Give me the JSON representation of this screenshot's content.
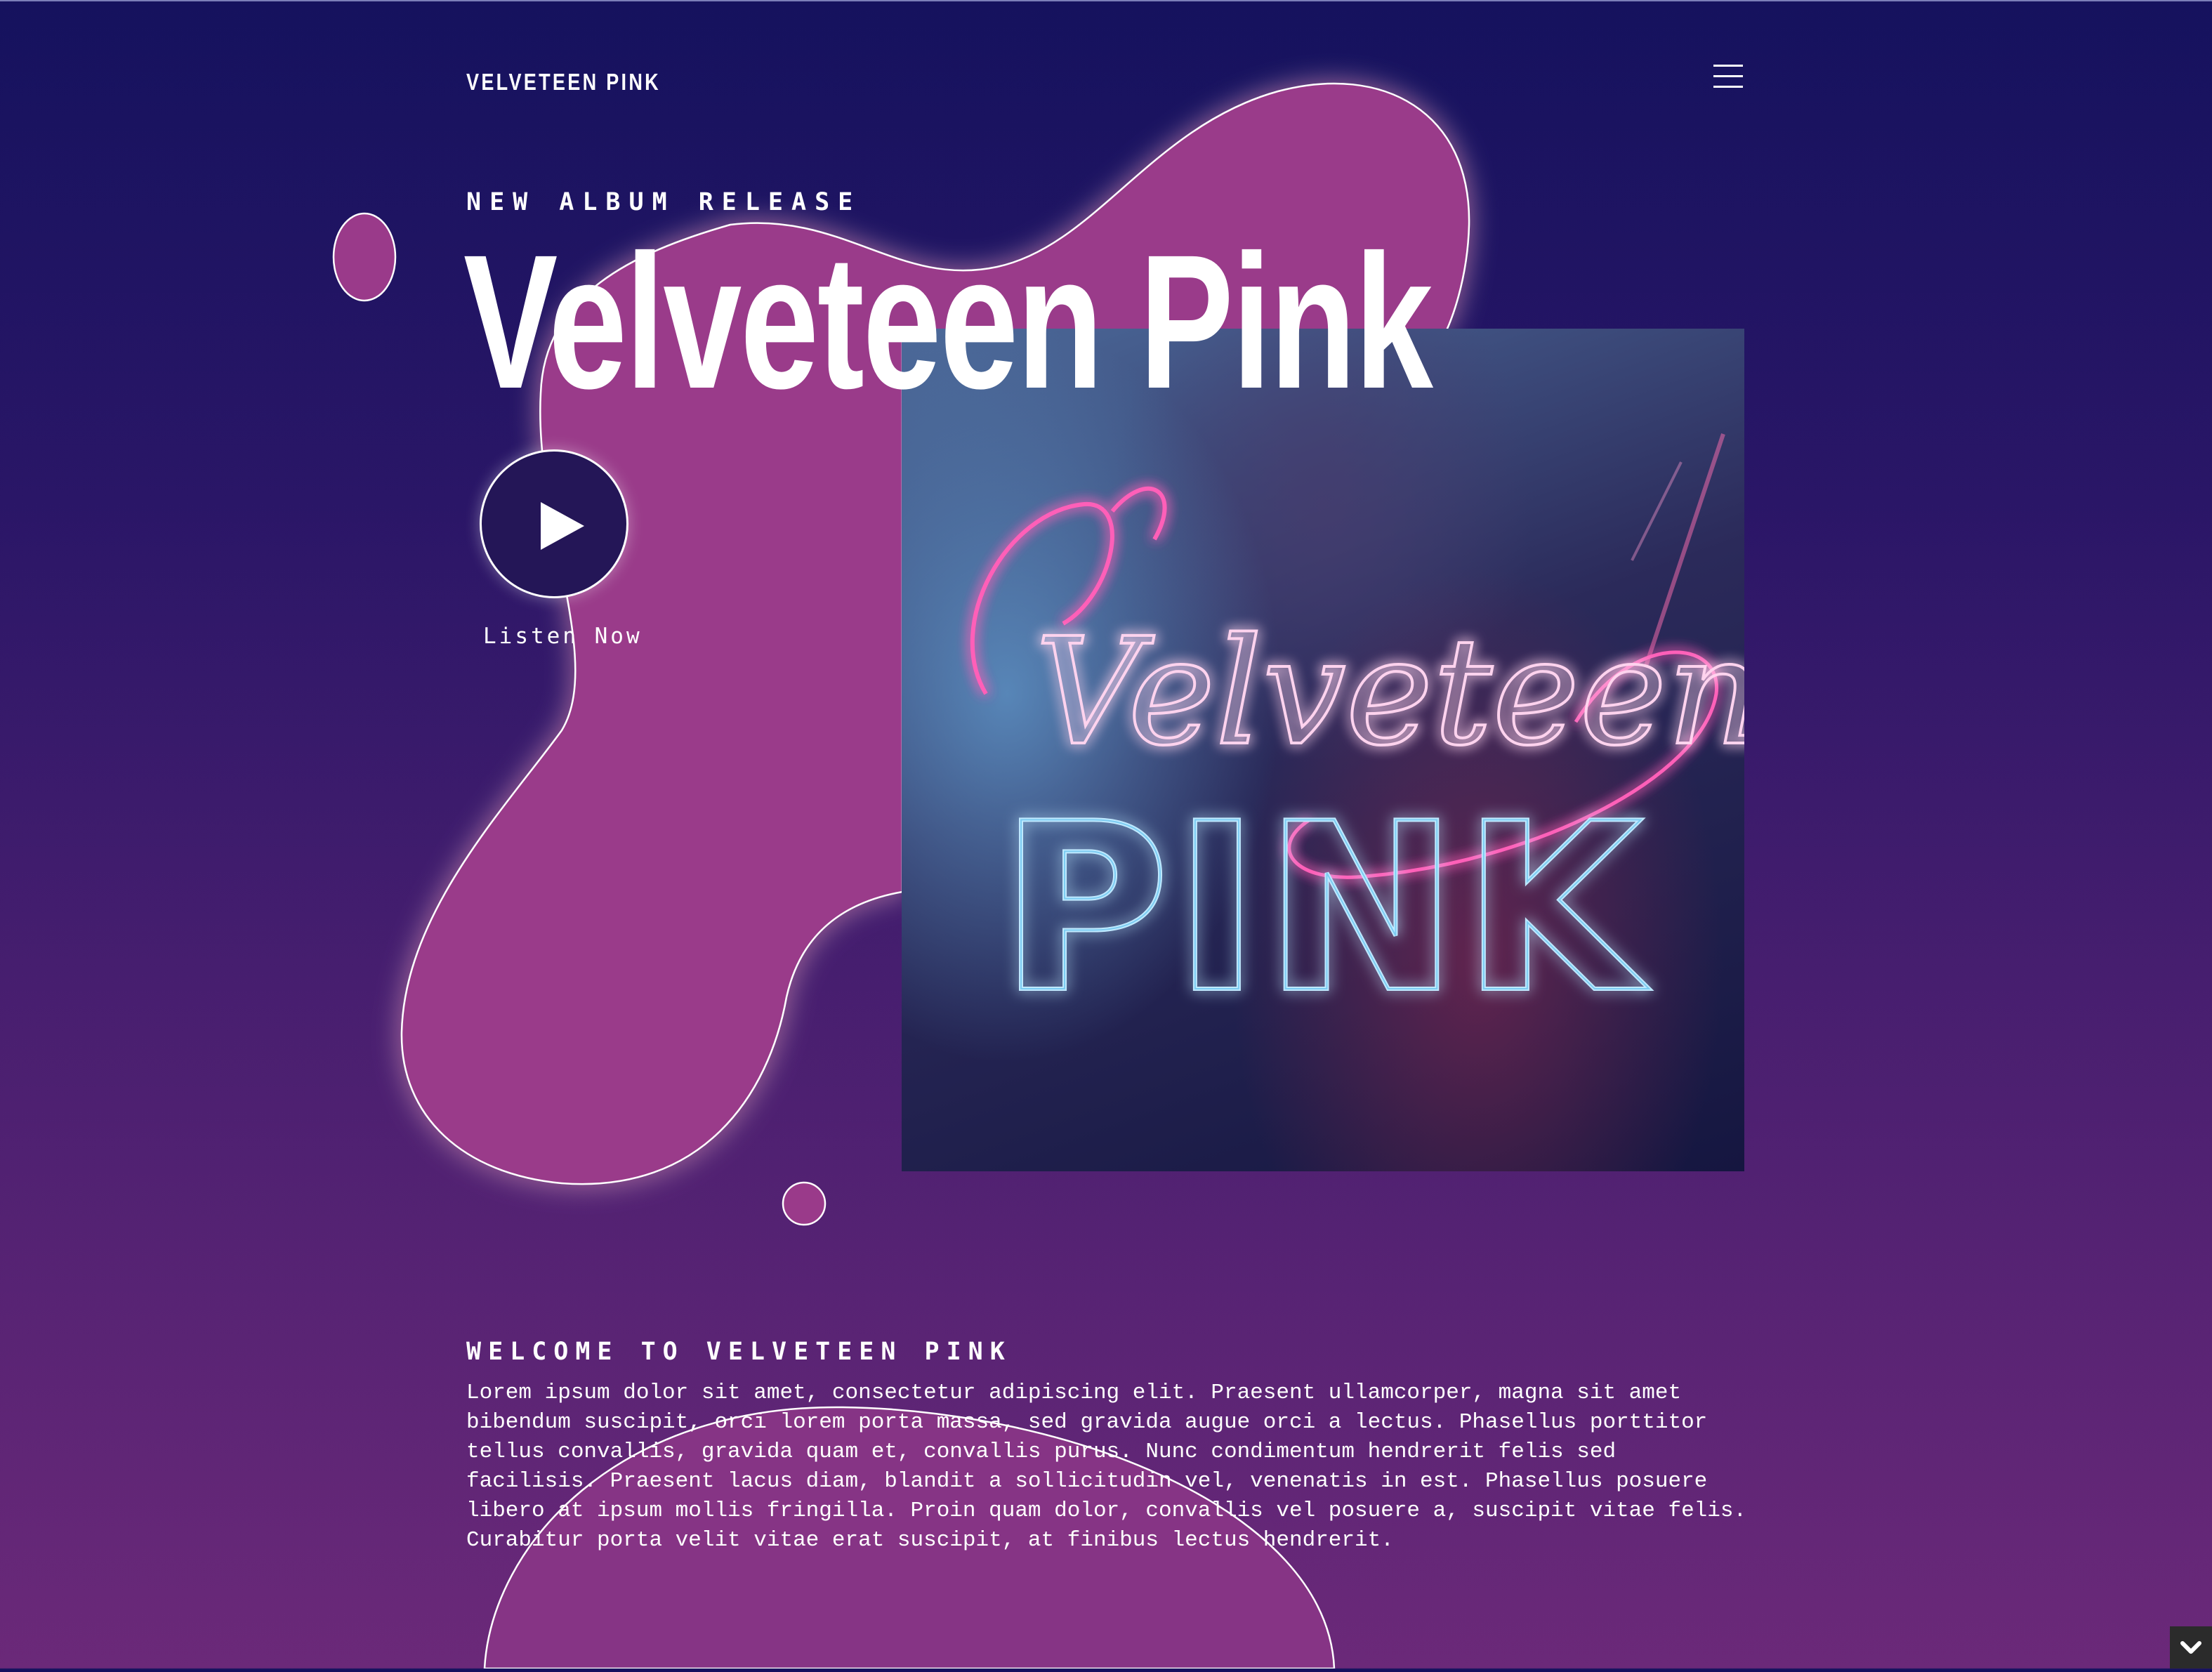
{
  "header": {
    "brand": "VELVETEEN PINK",
    "menu_icon": "hamburger-menu-icon"
  },
  "hero": {
    "kicker": "NEW ALBUM RELEASE",
    "title": "Velveteen Pink",
    "play_icon": "play-icon",
    "listen_label": "Listen Now",
    "album_cover": {
      "script_text": "Velveteen",
      "block_text": "PINK"
    }
  },
  "welcome": {
    "heading": "WELCOME TO VELVETEEN PINK",
    "body": "Lorem ipsum dolor sit amet, consectetur adipiscing elit. Praesent ullamcorper, magna sit amet bibendum suscipit, orci lorem porta massa, sed gravida augue orci a lectus. Phasellus porttitor tellus convallis, gravida quam et, convallis purus. Nunc condimentum hendrerit felis sed facilisis. Praesent lacus diam, blandit a sollicitudin vel, venenatis in est. Phasellus posuere libero at ipsum mollis fringilla. Proin quam dolor, convallis vel posuere a, suscipit vitae felis. Curabitur porta velit vitae erat suscipit, at finibus lectus hendrerit."
  },
  "scroll_icon": "chevron-down-icon",
  "colors": {
    "background_top": "#15125e",
    "background_bottom": "#6b2979",
    "blob": "#9a3a8a",
    "neon_pink": "#ff5fb8",
    "neon_blue": "#7fd3ff"
  }
}
